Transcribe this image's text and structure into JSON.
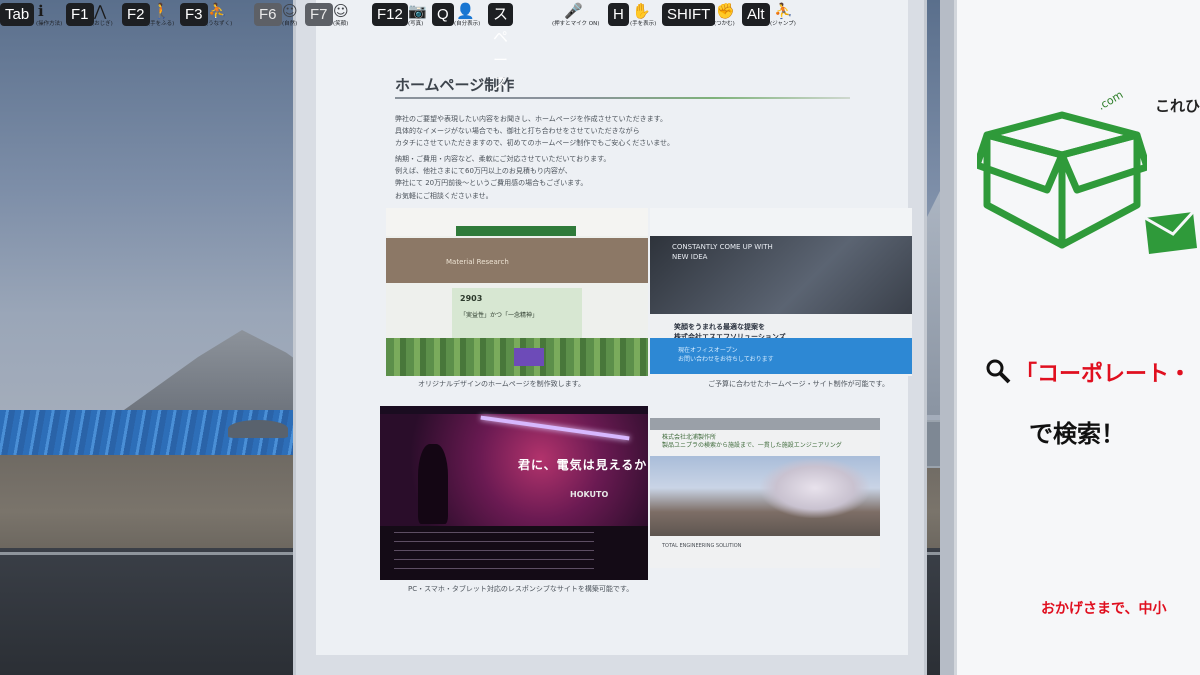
{
  "hud": {
    "keys": [
      {
        "key": "Tab",
        "label": "(操作方法)",
        "icon": "info-icon",
        "glyph": "ℹ"
      },
      {
        "key": "F1",
        "label": "(おじぎ)",
        "icon": "bow-icon",
        "glyph": "⋀"
      },
      {
        "key": "F2",
        "label": "(手をふる)",
        "icon": "wave-icon",
        "glyph": "🚶"
      },
      {
        "key": "F3",
        "label": "(うなずく)",
        "icon": "nod-icon",
        "glyph": "⛹"
      },
      {
        "key": "F6",
        "label": "(自然)",
        "icon": "smile-icon",
        "glyph": "☺"
      },
      {
        "key": "F7",
        "label": "(笑顔)",
        "icon": "laugh-icon",
        "glyph": "☺"
      },
      {
        "key": "F12",
        "label": "(写真)",
        "icon": "camera-icon",
        "glyph": "📷"
      },
      {
        "key": "Q",
        "label": "(自分表示)",
        "icon": "person-add-icon",
        "glyph": "👤"
      },
      {
        "key": "スペース",
        "label": "(押すとマイク ON)",
        "icon": "mic-icon",
        "glyph": "🎤"
      },
      {
        "key": "H",
        "label": "(手を表示)",
        "icon": "hand-icon",
        "glyph": "✋"
      },
      {
        "key": "SHIFT",
        "label": "(つかむ)",
        "icon": "grab-icon",
        "glyph": "✊"
      },
      {
        "key": "Alt",
        "label": "(ジャンプ)",
        "icon": "jump-icon",
        "glyph": "⛹"
      }
    ]
  },
  "website": {
    "title": "ホームページ制作",
    "paragraph1": [
      "弊社のご要望や表現したい内容をお聞きし、ホームページを作成させていただきます。",
      "具体的なイメージがない場合でも、御社と打ち合わせをさせていただきながら",
      "カタチにさせていただきますので、初めてのホームページ制作でもご安心くださいませ。"
    ],
    "paragraph2": [
      "納期・ご費用・内容など、柔軟にご対応させていただいております。",
      "例えば、他社さまにて60万円以上のお見積もり内容が、",
      "弊社にて 20万円前後〜というご費用感の場合もございます。"
    ],
    "paragraph3": "お気軽にご相談くださいませ。",
    "shot1": {
      "banner_text": "Material Research",
      "feature_num": "2903",
      "feature_text": "「実益性」かつ「一念精神」"
    },
    "shot2": {
      "hero_line1": "CONSTANTLY COME UP WITH",
      "hero_line2": "NEW IDEA",
      "sub_line1": "笑顔をうまれる最適な提案を",
      "sub_line2": "株式会社エスエフソリューションズ",
      "blue_line1": "現在オフィスオープン",
      "blue_line2": "お問い合わせをお待ちしております"
    },
    "shot3": {
      "copy": "君に、電気は見えるか",
      "logo": "HOKUTO"
    },
    "shot4": {
      "sub_line1": "株式会社北浦製作所",
      "sub_line2": "製品ユニプラの検索から施設まで、一貫した施設エンジニアリング",
      "text_line1": "TOTAL ENGINEERING SOLUTION"
    },
    "caption1": "オリジナルデザインのホームページを制作致します。",
    "caption2": "ご予算に合わせたホームページ・サイト制作が可能です。",
    "caption3": "PC・スマホ・タブレット対応のレスポンシブなサイトを構築可能です。"
  },
  "advert": {
    "top_text": "これひ",
    "com": ".com",
    "search_text": "「コーポレート・",
    "search_suffix": "で検索！",
    "bottom_text": "おかげさまで、中小"
  },
  "colors": {
    "accent_green": "#2f9a3a",
    "accent_red": "#e00f1f",
    "hud_key_bg": "#1d1f22"
  }
}
